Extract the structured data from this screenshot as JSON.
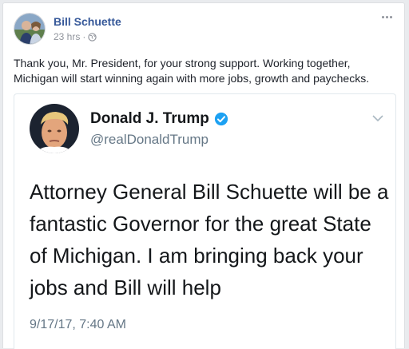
{
  "post": {
    "author": "Bill Schuette",
    "time": "23 hrs",
    "separator": "·",
    "privacy_icon": "globe-icon",
    "more_icon": "more-options-icon",
    "text": "Thank you, Mr. President, for your strong support. Working together, Michigan will start winning again with more jobs, growth and paychecks."
  },
  "tweet": {
    "name": "Donald J. Trump",
    "verified_icon": "verified-badge-icon",
    "handle": "@realDonaldTrump",
    "menu_icon": "chevron-down-icon",
    "text": "Attorney General Bill Schuette will be a fantastic Governor for the great State of Michigan. I am bringing back your jobs and Bill will help",
    "date": "9/17/17, 7:40 AM"
  },
  "colors": {
    "link": "#365899",
    "verified": "#1da1f2",
    "muted": "#90949c"
  }
}
